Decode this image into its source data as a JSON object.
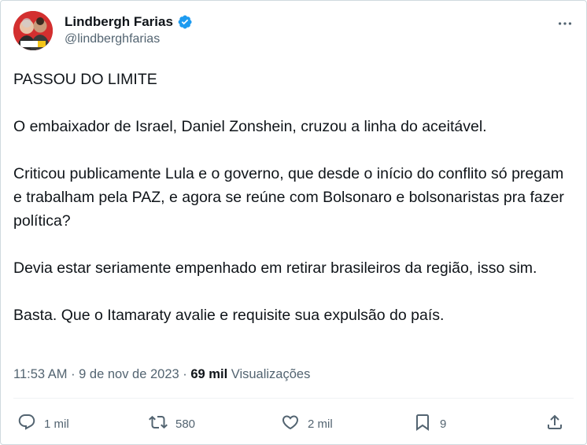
{
  "author": {
    "display_name": "Lindbergh Farias",
    "handle": "@lindberghfarias",
    "verified": true,
    "avatar_badge_text": "LULA 13"
  },
  "tweet": {
    "paragraphs": [
      "PASSOU DO LIMITE",
      "O embaixador de Israel, Daniel Zonshein, cruzou a linha do aceitável.",
      "Criticou publicamente Lula e o governo, que desde o início do conflito só pregam e trabalham pela PAZ, e agora se reúne com Bolsonaro e bolsonaristas pra fazer política?",
      "Devia estar seriamente empenhado em retirar brasileiros da região, isso sim.",
      "Basta. Que o Itamaraty avalie e requisite sua expulsão do país."
    ]
  },
  "meta": {
    "time": "11:53 AM",
    "separator": " · ",
    "date": "9 de nov de 2023",
    "views_count": "69 mil",
    "views_label": "Visualizações"
  },
  "actions": {
    "replies": "1 mil",
    "retweets": "580",
    "likes": "2 mil",
    "bookmarks": "9"
  },
  "colors": {
    "text": "#0f1419",
    "secondary": "#536471",
    "verified_blue": "#1d9bf0",
    "avatar_red": "#c62828"
  },
  "icons": [
    "more-icon",
    "verified-icon",
    "reply-icon",
    "retweet-icon",
    "like-icon",
    "bookmark-icon",
    "share-icon"
  ]
}
